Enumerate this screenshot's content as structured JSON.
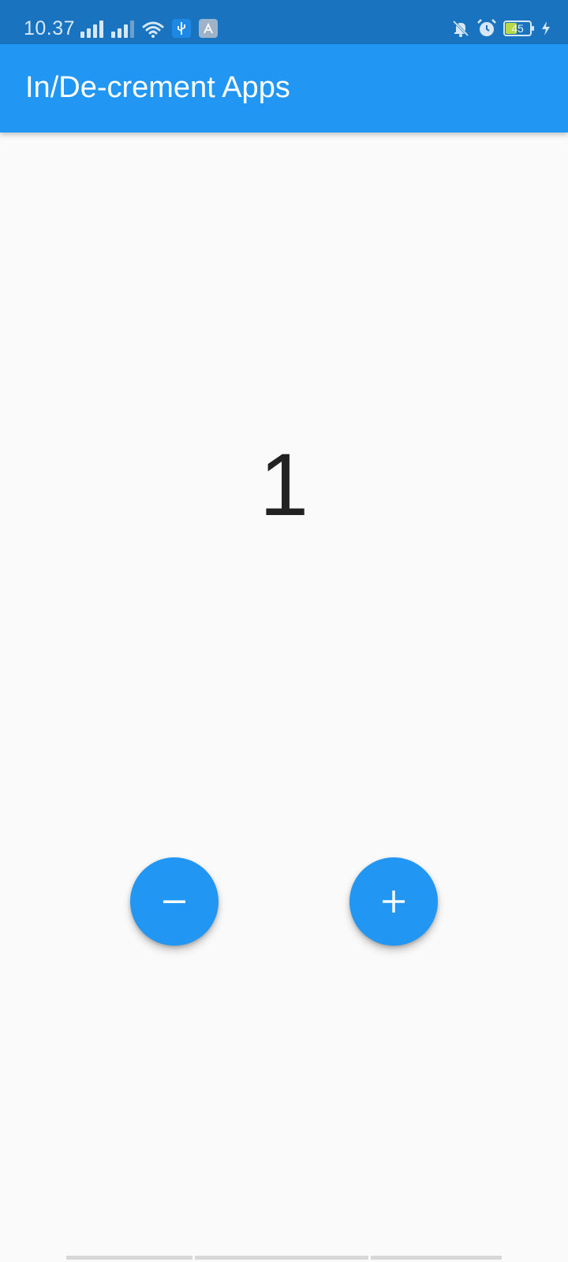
{
  "status_bar": {
    "time": "10.37",
    "battery_level": "45",
    "battery_fraction": 0.45,
    "charging": true,
    "icons": [
      "signal-icon",
      "signal-icon",
      "wifi-icon",
      "usb-icon",
      "app-notification-icon",
      "notifications-off-icon",
      "alarm-icon",
      "battery-icon",
      "charging-icon"
    ]
  },
  "app_bar": {
    "title": "In/De-crement Apps",
    "color": "#2196f3"
  },
  "counter": {
    "value": "1"
  },
  "buttons": {
    "decrement_icon": "minus-icon",
    "increment_icon": "plus-icon",
    "color": "#2196f3"
  }
}
